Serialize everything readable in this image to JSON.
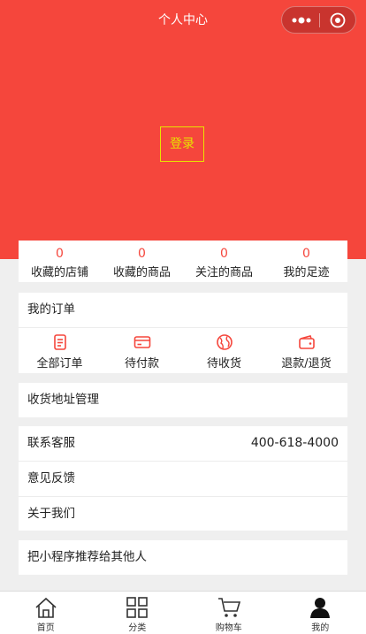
{
  "nav": {
    "title": "个人中心"
  },
  "login": {
    "label": "登录"
  },
  "stats": [
    {
      "count": "0",
      "label": "收藏的店铺"
    },
    {
      "count": "0",
      "label": "收藏的商品"
    },
    {
      "count": "0",
      "label": "关注的商品"
    },
    {
      "count": "0",
      "label": "我的足迹"
    }
  ],
  "orders": {
    "title": "我的订单",
    "items": [
      {
        "label": "全部订单",
        "icon": "order-list-icon"
      },
      {
        "label": "待付款",
        "icon": "card-icon"
      },
      {
        "label": "待收货",
        "icon": "globe-icon"
      },
      {
        "label": "退款/退货",
        "icon": "wallet-icon"
      }
    ]
  },
  "address": {
    "label": "收货地址管理"
  },
  "service": {
    "contact_label": "联系客服",
    "phone": "400-618-4000",
    "feedback_label": "意见反馈",
    "about_label": "关于我们"
  },
  "share": {
    "label": "把小程序推荐给其他人"
  },
  "tabbar": [
    {
      "label": "首页",
      "icon": "home-icon"
    },
    {
      "label": "分类",
      "icon": "grid-icon"
    },
    {
      "label": "购物车",
      "icon": "cart-icon"
    },
    {
      "label": "我的",
      "icon": "user-icon"
    }
  ],
  "colors": {
    "accent": "#f5463c",
    "login_border": "#e8e400",
    "page_bg": "#efefef"
  }
}
